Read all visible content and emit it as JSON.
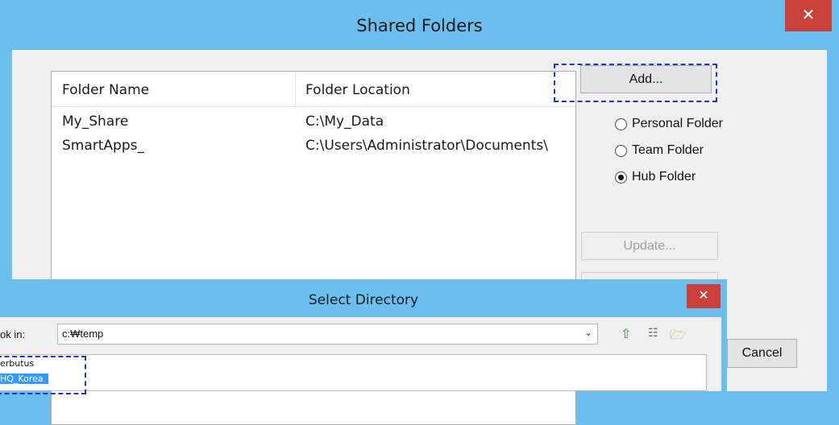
{
  "main": {
    "title": "Shared Folders",
    "close": "✕",
    "columns": [
      "Folder Name",
      "Folder Location"
    ],
    "rows": [
      {
        "name": "My_Share",
        "location": "C:\\My_Data"
      },
      {
        "name": "SmartApps_",
        "location": "C:\\Users\\Administrator\\Documents\\"
      }
    ],
    "add_label": "Add...",
    "radios": [
      {
        "label": "Personal Folder",
        "checked": false
      },
      {
        "label": "Team Folder",
        "checked": false
      },
      {
        "label": "Hub Folder",
        "checked": true
      }
    ],
    "update_label": "Update...",
    "cancel_label": "Cancel"
  },
  "select_dir": {
    "title": "Select Directory",
    "close": "✕",
    "look_in_label": "ok in:",
    "path": "c:₩temp",
    "tree": [
      "erbutus",
      "HQ_Korea"
    ]
  }
}
